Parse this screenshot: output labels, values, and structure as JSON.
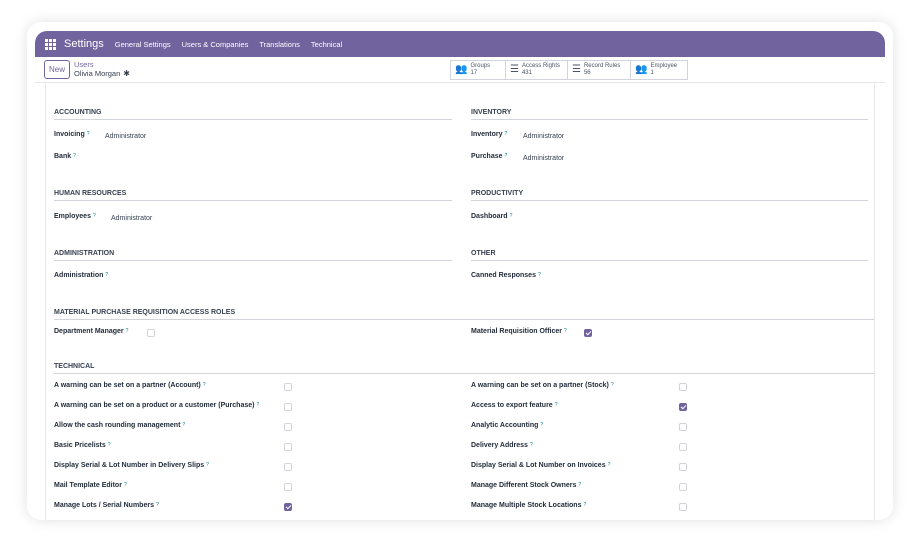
{
  "topbar": {
    "app_title": "Settings",
    "menu": [
      "General Settings",
      "Users & Companies",
      "Translations",
      "Technical"
    ]
  },
  "control": {
    "new_label": "New",
    "breadcrumb_parent": "Users",
    "breadcrumb_current": "Olivia Morgan"
  },
  "stat_buttons": [
    {
      "label": "Groups",
      "count": "17",
      "icon": "users-icon"
    },
    {
      "label": "Access Rights",
      "count": "431",
      "icon": "list-icon"
    },
    {
      "label": "Record Rules",
      "count": "56",
      "icon": "list-icon"
    },
    {
      "label": "Employee",
      "count": "1",
      "icon": "users-icon"
    }
  ],
  "sections": {
    "accounting": {
      "title": "ACCOUNTING",
      "invoicing": {
        "label": "Invoicing",
        "value": "Administrator"
      },
      "bank": {
        "label": "Bank"
      }
    },
    "inventory": {
      "title": "INVENTORY",
      "inventory": {
        "label": "Inventory",
        "value": "Administrator"
      },
      "purchase": {
        "label": "Purchase",
        "value": "Administrator"
      }
    },
    "human_resources": {
      "title": "HUMAN RESOURCES",
      "employees": {
        "label": "Employees",
        "value": "Administrator"
      }
    },
    "productivity": {
      "title": "PRODUCTIVITY",
      "dashboard": {
        "label": "Dashboard"
      }
    },
    "administration": {
      "title": "ADMINISTRATION",
      "administration": {
        "label": "Administration"
      }
    },
    "other": {
      "title": "OTHER",
      "canned": {
        "label": "Canned Responses"
      }
    },
    "mpr": {
      "title": "MATERIAL PURCHASE REQUISITION ACCESS ROLES",
      "dept_manager": {
        "label": "Department Manager",
        "checked": false
      },
      "mr_officer": {
        "label": "Material Requisition Officer",
        "checked": true
      }
    },
    "technical": {
      "title": "TECHNICAL",
      "left": [
        {
          "label": "A warning can be set on a partner (Account)",
          "checked": false
        },
        {
          "label": "A warning can be set on a product or a customer (Purchase)",
          "checked": false
        },
        {
          "label": "Allow the cash rounding management",
          "checked": false
        },
        {
          "label": "Basic Pricelists",
          "checked": false
        },
        {
          "label": "Display Serial & Lot Number in Delivery Slips",
          "checked": false
        },
        {
          "label": "Mail Template Editor",
          "checked": false
        },
        {
          "label": "Manage Lots / Serial Numbers",
          "checked": true
        }
      ],
      "right": [
        {
          "label": "A warning can be set on a partner (Stock)",
          "checked": false
        },
        {
          "label": "Access to export feature",
          "checked": true
        },
        {
          "label": "Analytic Accounting",
          "checked": false
        },
        {
          "label": "Delivery Address",
          "checked": false
        },
        {
          "label": "Display Serial & Lot Number on Invoices",
          "checked": false
        },
        {
          "label": "Manage Different Stock Owners",
          "checked": false
        },
        {
          "label": "Manage Multiple Stock Locations",
          "checked": false
        }
      ]
    }
  },
  "help_mark": "?",
  "colors": {
    "accent": "#71639e",
    "help": "#017e84"
  }
}
